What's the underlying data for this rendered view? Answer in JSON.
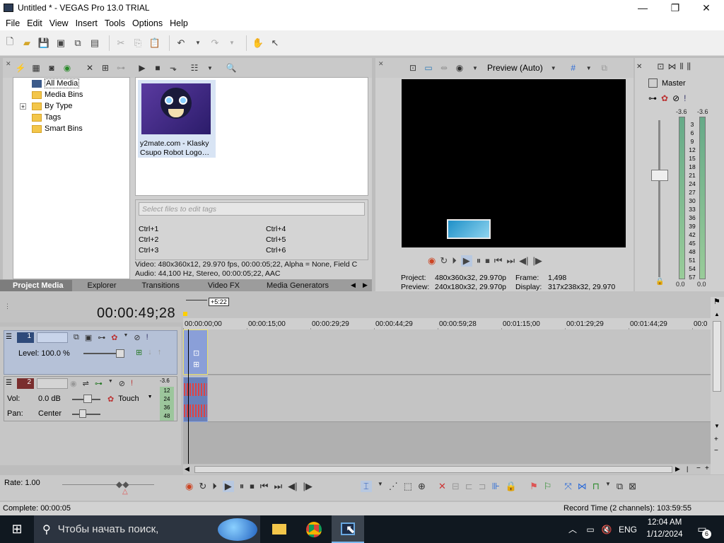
{
  "window": {
    "title": "Untitled * - VEGAS Pro 13.0 TRIAL",
    "minimize": "—",
    "maximize": "❐",
    "close": "✕"
  },
  "menu": [
    "File",
    "Edit",
    "View",
    "Insert",
    "Tools",
    "Options",
    "Help"
  ],
  "project_media": {
    "tree": [
      {
        "label": "All Media",
        "selected": true
      },
      {
        "label": "Media Bins"
      },
      {
        "label": "By Type",
        "expand": "+"
      },
      {
        "label": "Tags"
      },
      {
        "label": "Smart Bins"
      }
    ],
    "media_item": {
      "line1": "y2mate.com - Klasky",
      "line2": "Csupo Robot Logo…"
    },
    "tag_placeholder": "Select files to edit tags",
    "shortcuts": [
      "Ctrl+1",
      "Ctrl+4",
      "Ctrl+2",
      "Ctrl+5",
      "Ctrl+3",
      "Ctrl+6"
    ],
    "info_video": "Video: 480x360x12, 29.970 fps, 00:00:05;22, Alpha = None, Field C",
    "info_audio": "Audio: 44,100 Hz, Stereo, 00:00:05;22, AAC",
    "tabs": [
      "Project Media",
      "Explorer",
      "Transitions",
      "Video FX",
      "Media Generators"
    ]
  },
  "preview": {
    "mode": "Preview (Auto)",
    "project_label": "Project:",
    "project_value": "480x360x32, 29.970p",
    "preview_label": "Preview:",
    "preview_value": "240x180x32, 29.970p",
    "frame_label": "Frame:",
    "frame_value": "1,498",
    "display_label": "Display:",
    "display_value": "317x238x32, 29.970"
  },
  "master": {
    "title": "Master",
    "peak_left": "-3.6",
    "peak_right": "-3.6",
    "scale": [
      "3",
      "6",
      "9",
      "12",
      "15",
      "18",
      "21",
      "24",
      "27",
      "30",
      "33",
      "36",
      "39",
      "42",
      "45",
      "48",
      "51",
      "54",
      "57"
    ],
    "bottom_left": "0.0",
    "bottom_right": "0.0"
  },
  "timeline": {
    "timecode": "00:00:49;28",
    "marker": "+5:22",
    "ruler": [
      "00:00:00;00",
      "00:00:15;00",
      "00:00:29;29",
      "00:00:44;29",
      "00:00:59;28",
      "00:01:15;00",
      "00:01:29;29",
      "00:01:44;29",
      "00:0"
    ],
    "track1": {
      "number": "1",
      "level": "Level: 100.0 %"
    },
    "track2": {
      "number": "2",
      "vol_label": "Vol:",
      "vol_value": "0.0 dB",
      "pan_label": "Pan:",
      "pan_value": "Center",
      "touch": "Touch",
      "meter_top": "-3.6",
      "meter_scale": [
        "12",
        "24",
        "36",
        "48"
      ]
    },
    "rate": "Rate: 1.00"
  },
  "status": {
    "left": "Complete: 00:00:05",
    "right": "Record Time (2 channels): 103:59:55"
  },
  "taskbar": {
    "search_placeholder": "Чтобы начать поиск,",
    "lang": "ENG",
    "time": "12:04 AM",
    "date": "1/12/2024",
    "notif_count": "6"
  },
  "colors": {
    "workspace": "#bdbdbd",
    "track_video": "#b5c1d7",
    "clip": "#8a9fd8",
    "taskbar": "#101820"
  }
}
